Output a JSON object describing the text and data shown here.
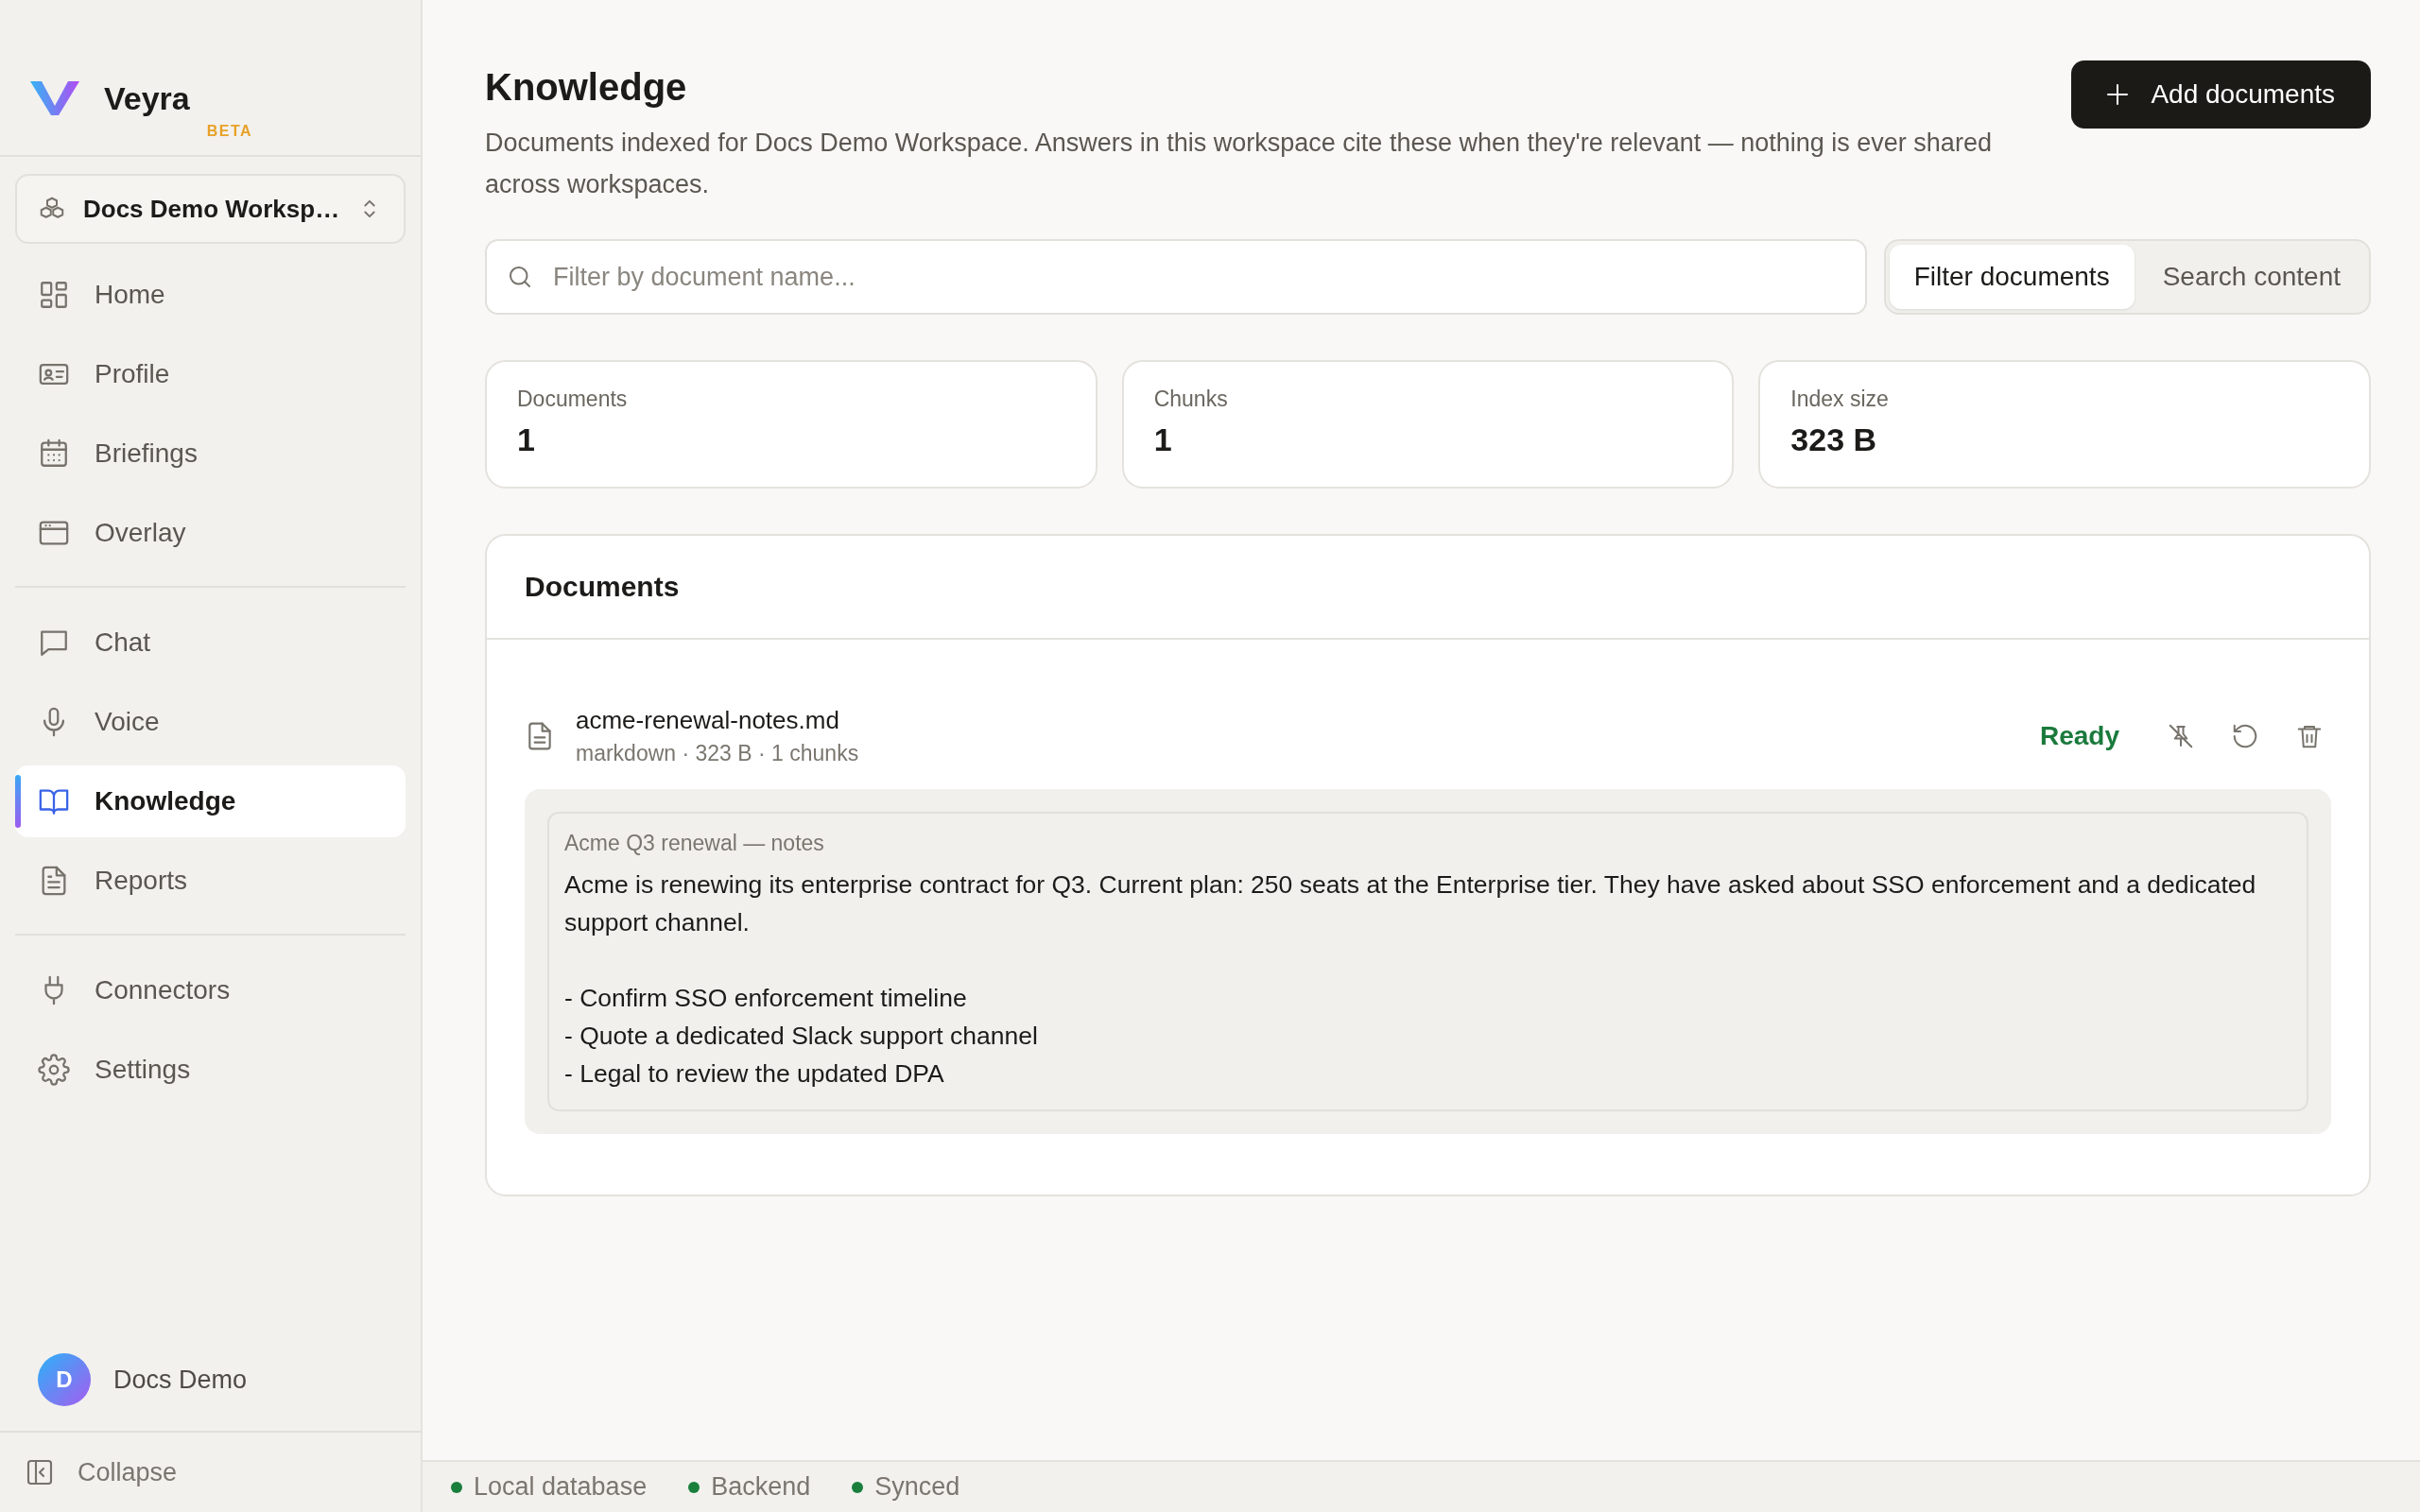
{
  "sidebar": {
    "brand": {
      "name": "Veyra",
      "badge": "BETA"
    },
    "workspace": {
      "name": "Docs Demo Worksp…"
    },
    "nav_groups": [
      [
        {
          "label": "Home",
          "selected": false
        },
        {
          "label": "Profile",
          "selected": false
        },
        {
          "label": "Briefings",
          "selected": false
        },
        {
          "label": "Overlay",
          "selected": false
        }
      ],
      [
        {
          "label": "Chat",
          "selected": false
        },
        {
          "label": "Voice",
          "selected": false
        },
        {
          "label": "Knowledge",
          "selected": true
        },
        {
          "label": "Reports",
          "selected": false
        }
      ],
      [
        {
          "label": "Connectors",
          "selected": false
        },
        {
          "label": "Settings",
          "selected": false
        }
      ]
    ],
    "user": {
      "initial": "D",
      "name": "Docs Demo"
    },
    "collapse": "Collapse"
  },
  "main": {
    "title": "Knowledge",
    "description": "Documents indexed for Docs Demo Workspace. Answers in this workspace cite these when they're relevant — nothing is ever shared across workspaces.",
    "add_button": "Add documents",
    "search": {
      "placeholder": "Filter by document name..."
    },
    "view_tabs": [
      {
        "label": "Filter documents",
        "selected": true
      },
      {
        "label": "Search content",
        "selected": false
      }
    ],
    "stats": [
      {
        "label": "Documents",
        "value": "1"
      },
      {
        "label": "Chunks",
        "value": "1"
      },
      {
        "label": "Index size",
        "value": "323 B"
      }
    ],
    "documents": {
      "title": "Documents",
      "items": [
        {
          "name": "acme-renewal-notes.md",
          "meta": "markdown · 323 B · 1 chunks",
          "status": "Ready",
          "preview": {
            "title": "Acme Q3 renewal — notes",
            "paragraph": "Acme is renewing its enterprise contract for Q3. Current plan: 250 seats at the Enterprise tier. They have asked about SSO enforcement and a dedicated support channel.",
            "lines": [
              "- Confirm SSO enforcement timeline",
              "- Quote a dedicated Slack support channel",
              "- Legal to review the updated DPA"
            ]
          }
        }
      ]
    }
  },
  "status_bar": [
    {
      "label": "Local database",
      "color": "#1a7f3c"
    },
    {
      "label": "Backend",
      "color": "#1a7f3c"
    },
    {
      "label": "Synced",
      "color": "#1a7f3c"
    }
  ]
}
